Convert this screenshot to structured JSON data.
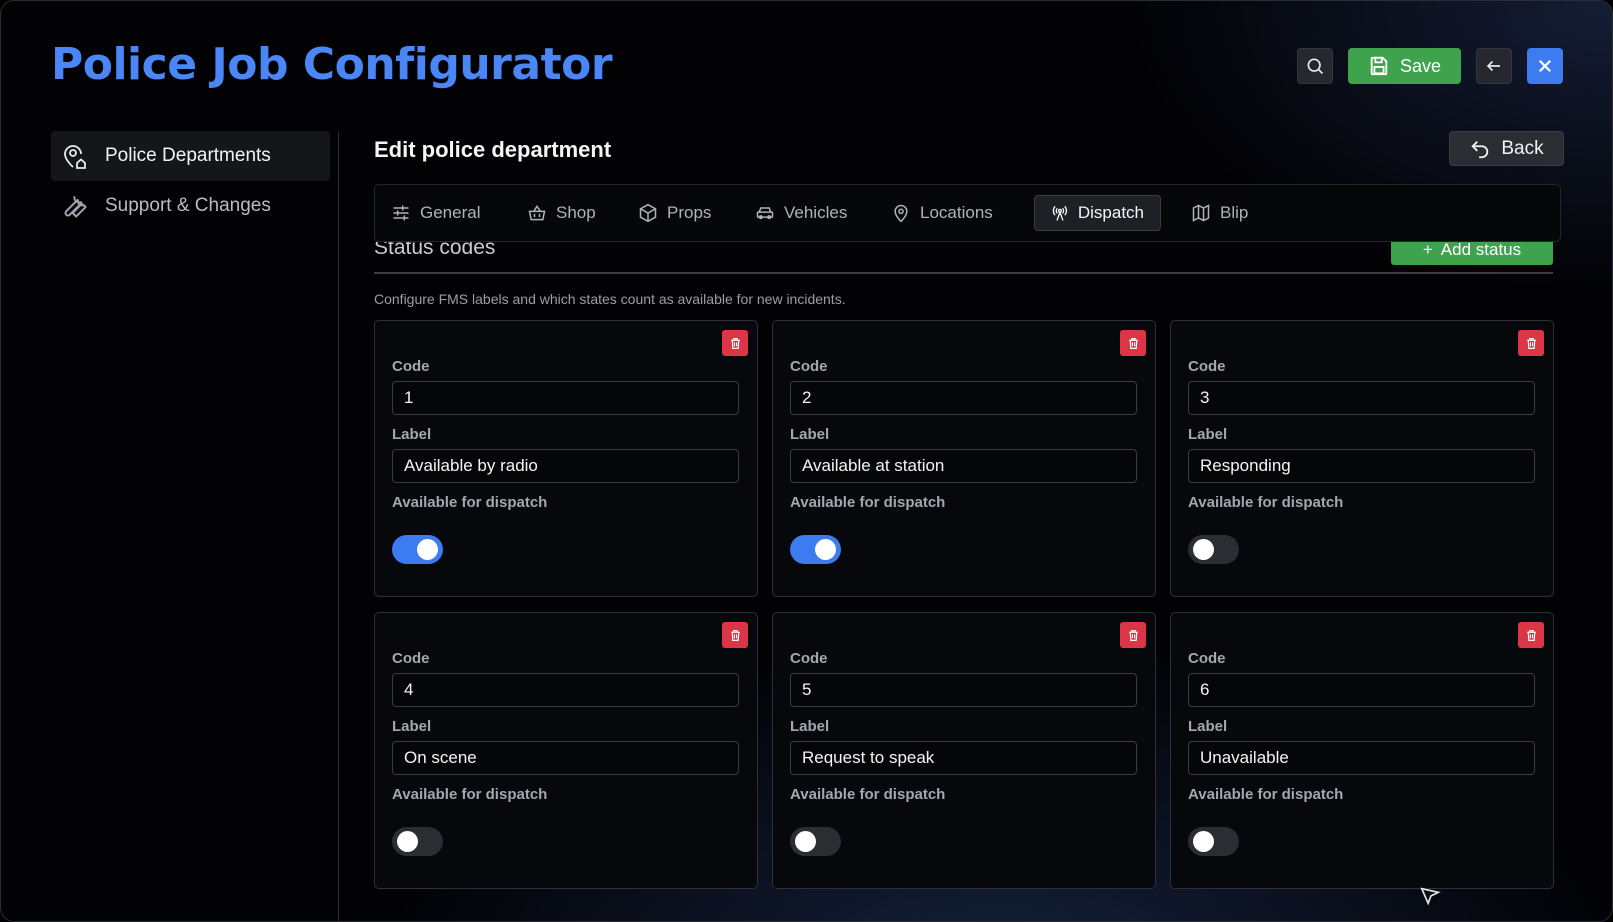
{
  "app": {
    "title": "Police Job Configurator",
    "save_label": "Save"
  },
  "sidebar": {
    "items": [
      {
        "label": "Police Departments",
        "active": true,
        "icon": "map-pin-home-icon"
      },
      {
        "label": "Support & Changes",
        "active": false,
        "icon": "wrench-icon"
      }
    ]
  },
  "page": {
    "heading": "Edit police department",
    "back_label": "Back"
  },
  "tabs": [
    {
      "label": "General",
      "icon": "sliders-icon",
      "active": false
    },
    {
      "label": "Shop",
      "icon": "basket-icon",
      "active": false
    },
    {
      "label": "Props",
      "icon": "box-icon",
      "active": false
    },
    {
      "label": "Vehicles",
      "icon": "car-icon",
      "active": false
    },
    {
      "label": "Locations",
      "icon": "map-pin-icon",
      "active": false
    },
    {
      "label": "Dispatch",
      "icon": "radio-tower-icon",
      "active": true
    },
    {
      "label": "Blip",
      "icon": "map-icon",
      "active": false
    }
  ],
  "section": {
    "title": "Status codes",
    "add_label": "Add status",
    "description": "Configure FMS labels and which states count as available for new incidents."
  },
  "field_labels": {
    "code": "Code",
    "label": "Label",
    "available": "Available for dispatch"
  },
  "statuses": [
    {
      "code": "1",
      "label": "Available by radio",
      "available": true
    },
    {
      "code": "2",
      "label": "Available at station",
      "available": true
    },
    {
      "code": "3",
      "label": "Responding",
      "available": false
    },
    {
      "code": "4",
      "label": "On scene",
      "available": false
    },
    {
      "code": "5",
      "label": "Request to speak",
      "available": false
    },
    {
      "code": "6",
      "label": "Unavailable",
      "available": false
    }
  ],
  "colors": {
    "accent_blue": "#3c7bf0",
    "title_blue": "#4a86f5",
    "save_green": "#3fa34d",
    "delete_red": "#dc3545"
  }
}
